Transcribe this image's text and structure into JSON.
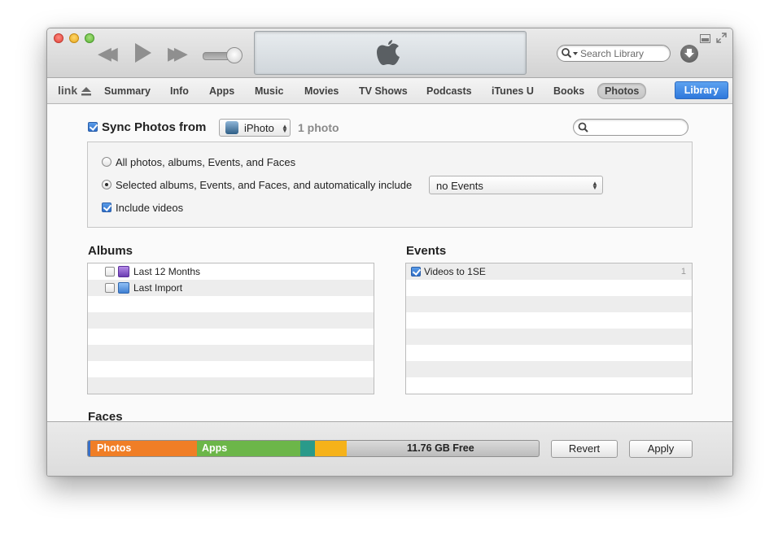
{
  "toolbar": {
    "search_placeholder": "Search Library"
  },
  "nav": {
    "device_name": "link",
    "tabs": [
      "Summary",
      "Info",
      "Apps",
      "Music",
      "Movies",
      "TV Shows",
      "Podcasts",
      "iTunes U",
      "Books",
      "Photos"
    ],
    "active_tab": "Photos",
    "library_label": "Library"
  },
  "sync": {
    "label": "Sync Photos from",
    "checked": true,
    "source": "iPhoto",
    "count": "1 photo",
    "options": {
      "all_label": "All photos, albums, Events, and Faces",
      "selected_label": "Selected albums, Events, and Faces, and automatically include",
      "selected_on": true,
      "events_choice": "no Events",
      "include_videos_label": "Include videos",
      "include_videos_checked": true
    }
  },
  "albums": {
    "title": "Albums",
    "items": [
      {
        "label": "Last 12 Months",
        "checked": false,
        "icon": "smart-album-icon"
      },
      {
        "label": "Last Import",
        "checked": false,
        "icon": "album-icon"
      }
    ]
  },
  "events": {
    "title": "Events",
    "items": [
      {
        "label": "Videos to 1SE",
        "checked": true,
        "count": "1"
      }
    ]
  },
  "faces": {
    "title": "Faces"
  },
  "capacity": {
    "segments": [
      {
        "label": "Photos",
        "color": "#f07e26"
      },
      {
        "label": "Apps",
        "color": "#6cb649"
      },
      {
        "label": "",
        "color": "#2a9a8a"
      },
      {
        "label": "",
        "color": "#f5b21a"
      }
    ],
    "free_label": "11.76 GB Free"
  },
  "buttons": {
    "revert": "Revert",
    "apply": "Apply"
  },
  "colors": {
    "accent": "#2f78dc",
    "close": "#e0443a",
    "minimize": "#e8a91e",
    "zoom": "#5eb53a"
  }
}
